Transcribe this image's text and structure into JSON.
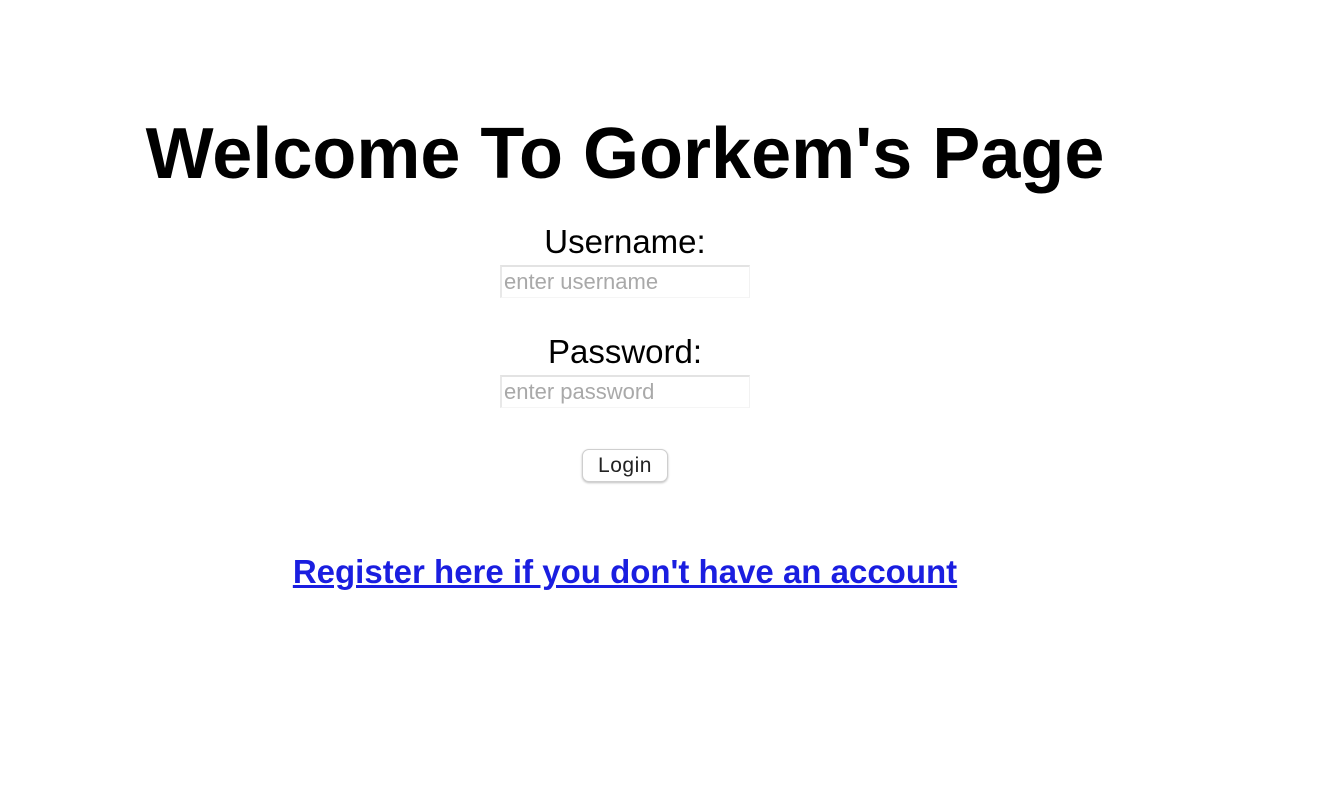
{
  "header": {
    "title": "Welcome To Gorkem's Page"
  },
  "form": {
    "username_label": "Username:",
    "username_placeholder": "enter username",
    "username_value": "",
    "password_label": "Password:",
    "password_placeholder": "enter password",
    "password_value": "",
    "login_label": "Login"
  },
  "footer": {
    "register_link_text": "Register here if you don't have an account",
    "link_color": "#1a1ee0"
  }
}
